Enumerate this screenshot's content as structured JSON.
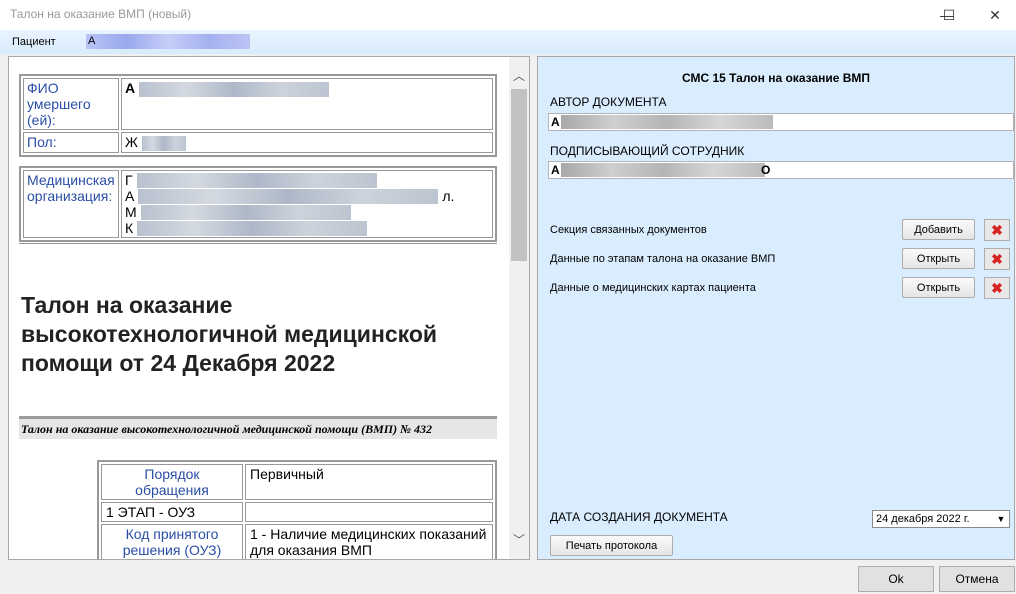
{
  "window": {
    "title": "Талон на оказание ВМП (новый)",
    "minimize_glyph": "—",
    "maximize_glyph": "☐",
    "close_glyph": "✕"
  },
  "patient": {
    "label": "Пациент",
    "value": "А"
  },
  "document": {
    "deceased_label": "ФИО умершего (ей):",
    "deceased_value": "А",
    "sex_label": "Пол:",
    "sex_value": "Ж",
    "org_label": "Медицинская организация:",
    "org_lines": [
      "Г",
      "А",
      "М",
      "К"
    ],
    "org_line2_tail": "л.",
    "main_title": "Талон на оказание высокотехнологичной медицинской помощи от 24 Декабря 2022",
    "subheader": "Талон на оказание высокотехнологичной медицинской помощи (ВМП) № 432",
    "procedure_rows": [
      {
        "key": "Порядок обращения",
        "value": "Первичный"
      },
      {
        "key": "1 ЭТАП - ОУЗ",
        "value": ""
      },
      {
        "key": "Код принятого решения (ОУЗ)",
        "value": "1 - Наличие медицинских показаний для оказания ВМП"
      }
    ]
  },
  "scrollbar": {
    "up_glyph": "︿",
    "down_glyph": "﹀"
  },
  "panel": {
    "title": "СМС 15 Талон на оказание ВМП",
    "author_label": "АВТОР ДОКУМЕНТА",
    "author_value": "А",
    "signer_label": "ПОДПИСЫВАЮЩИЙ СОТРУДНИК",
    "signer_value": "А",
    "signer_tail": "О",
    "sections": [
      {
        "label": "Секция связанных документов",
        "button": "Добавить"
      },
      {
        "label": "Данные по этапам талона на оказание ВМП",
        "button": "Открыть"
      },
      {
        "label": "Данные о медицинских картах пациента",
        "button": "Открыть"
      }
    ],
    "delete_glyph": "✖",
    "date_label": "ДАТА СОЗДАНИЯ ДОКУМЕНТА",
    "date_value": "24  декабря  2022 г.",
    "date_dropdown_glyph": "▼",
    "print_button": "Печать протокола"
  },
  "footer": {
    "ok": "Ok",
    "cancel": "Отмена"
  }
}
